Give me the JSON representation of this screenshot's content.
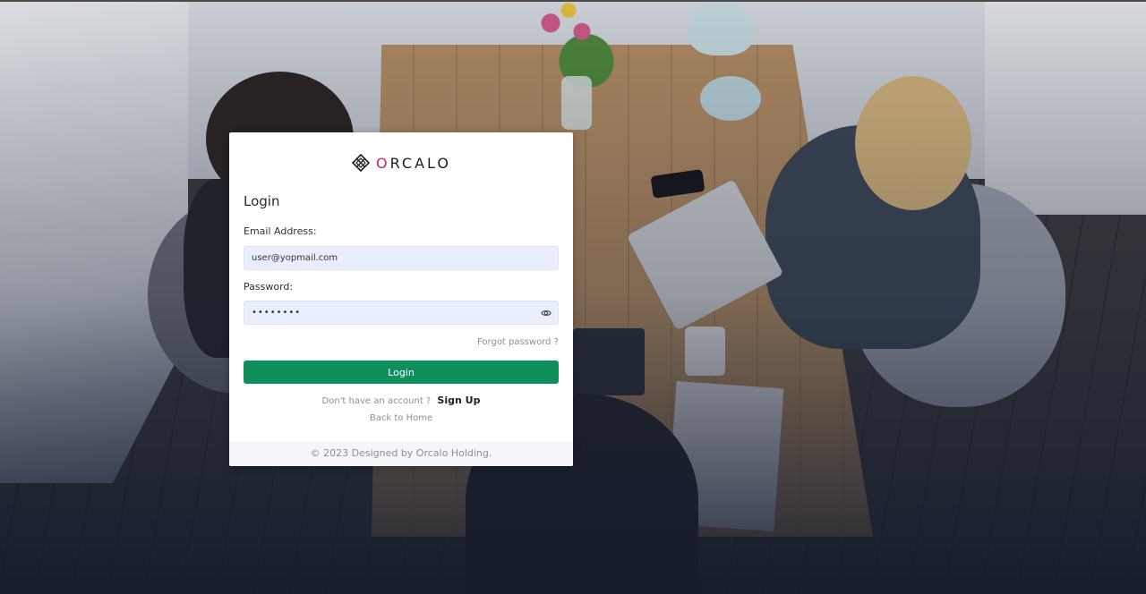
{
  "brand": {
    "name_part1": "O",
    "name_part2": "RCALO",
    "accent_color": "#d0245e"
  },
  "login": {
    "title": "Login",
    "email_label": "Email Address:",
    "email_value": "user@yopmail.com",
    "password_label": "Password:",
    "password_value": "password",
    "password_icon": "eye-icon",
    "forgot_label": "Forgot password ?",
    "submit_label": "Login",
    "submit_color": "#0f8f5e",
    "no_account_text": "Don't have an account ?",
    "signup_label": "Sign Up",
    "back_home_label": "Back to Home"
  },
  "footer": {
    "text": "© 2023 Designed by Orcalo Holding."
  }
}
